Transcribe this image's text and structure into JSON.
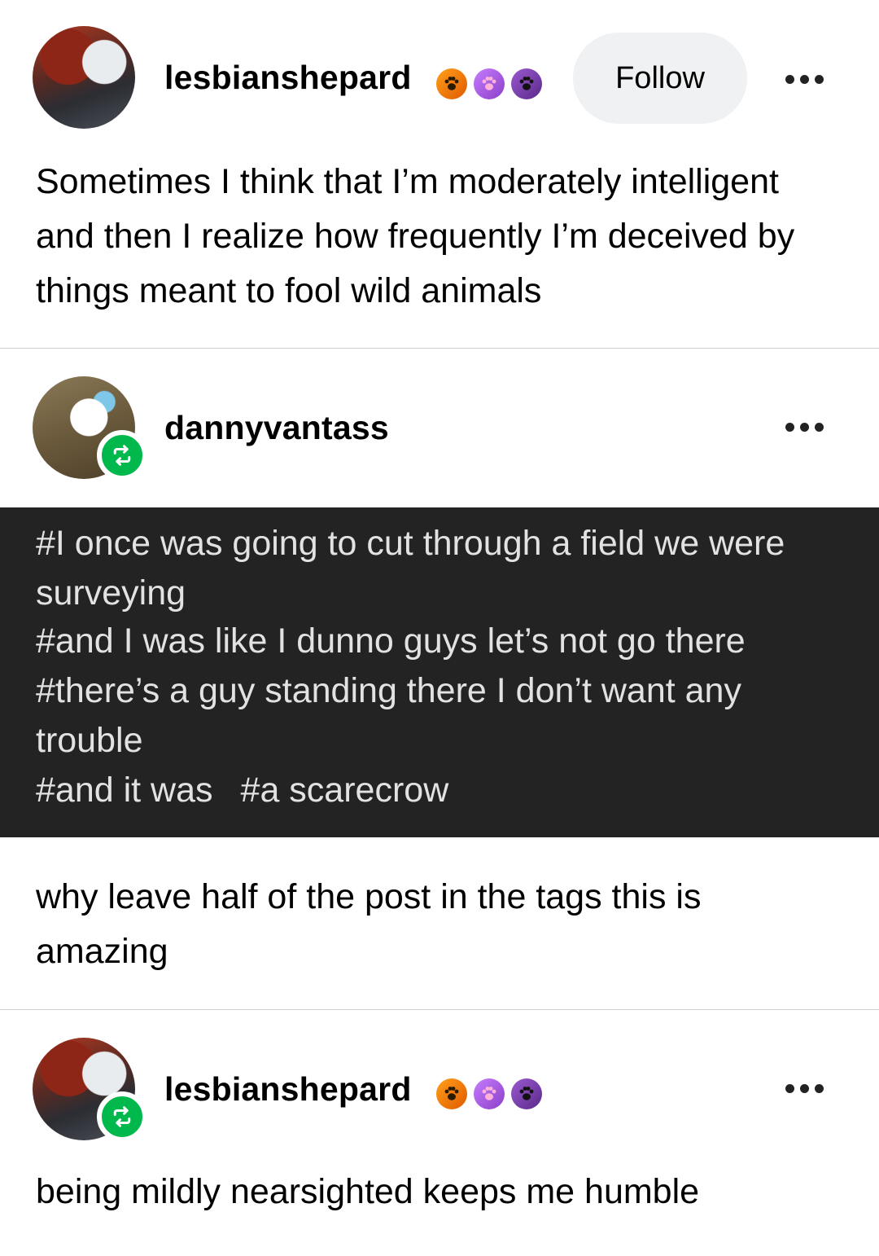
{
  "posts": [
    {
      "username": "lesbianshepard",
      "follow_label": "Follow",
      "text": "Sometimes I think that I’m moderately intelligent and then I realize how frequently I’m deceived by things meant to fool wild animals"
    },
    {
      "username": "dannyvantass",
      "tags": [
        "#I once was going to cut through a field we were surveying",
        "#and I was like I dunno guys let’s not go there",
        "#there’s a guy standing there I don’t want any trouble",
        "#and it was",
        "#a scarecrow"
      ]
    },
    {
      "text": "why leave half of the post in the tags this is amazing"
    },
    {
      "username": "lesbianshepard",
      "text": "being mildly nearsighted keeps me humble"
    }
  ],
  "colors": {
    "reblog_green": "#00b84c",
    "tag_background": "#232323",
    "follow_button_bg": "#f0f1f2"
  },
  "icons": [
    "reblog-icon",
    "paw-badge-icon",
    "more-options-icon"
  ]
}
